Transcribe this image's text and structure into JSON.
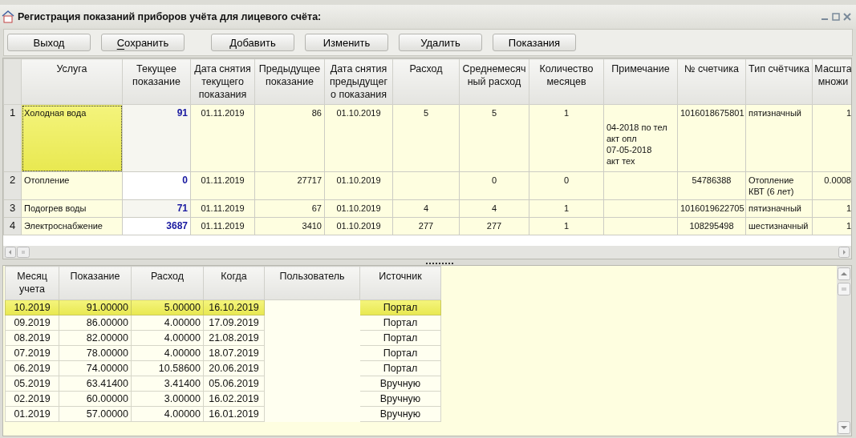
{
  "window": {
    "title": "Регистрация показаний приборов учёта для лицевого счёта:"
  },
  "toolbar": [
    {
      "label": "Выход",
      "mnemonic": false
    },
    {
      "label": "Сохранить",
      "mnemonic": true
    },
    {
      "label": "Добавить",
      "mnemonic": false
    },
    {
      "label": "Изменить",
      "mnemonic": false
    },
    {
      "label": "Удалить",
      "mnemonic": false
    },
    {
      "label": "Показания",
      "mnemonic": false
    }
  ],
  "readings_table": {
    "columns": [
      "Услуга",
      "Текущее показание",
      "Дата снятия текущего показания",
      "Предыдущее показание",
      "Дата снятия предыдущег о показания",
      "Расход",
      "Среднемесяч ный расход",
      "Количество месяцев",
      "Примечание",
      "№ счетчика",
      "Тип счётчика",
      "Масшта множи"
    ],
    "rows": [
      {
        "number": "1",
        "selected": true,
        "cells": [
          "Холодная вода",
          "91",
          "01.11.2019",
          "86",
          "01.10.2019",
          "5",
          "5",
          "1",
          "04-2018 по тел\nакт опл\n07-05-2018\nакт тех",
          "1016018675801",
          "пятизначный",
          "1"
        ]
      },
      {
        "number": "2",
        "selected": false,
        "cells": [
          "Отопление",
          "0",
          "01.11.2019",
          "27717",
          "01.10.2019",
          null,
          "0",
          "0",
          null,
          "54786388",
          "Отопление КВТ (6 лет)",
          "0.0008"
        ]
      },
      {
        "number": "3",
        "selected": false,
        "cells": [
          "Подогрев воды",
          "71",
          "01.11.2019",
          "67",
          "01.10.2019",
          "4",
          "4",
          "1",
          null,
          "1016019622705",
          "пятизначный",
          "1"
        ]
      },
      {
        "number": "4",
        "selected": false,
        "cells": [
          "Электроснабжение",
          "3687",
          "01.11.2019",
          "3410",
          "01.10.2019",
          "277",
          "277",
          "1",
          null,
          "108295498",
          "шестизначный",
          "1"
        ]
      }
    ]
  },
  "history_table": {
    "columns": [
      "Месяц учета",
      "Показание",
      "Расход",
      "Когда",
      "Пользователь",
      "Источник"
    ],
    "rows": [
      {
        "selected": true,
        "cells": [
          "10.2019",
          "91.00000",
          "5.00000",
          "16.10.2019",
          null,
          "Портал"
        ]
      },
      {
        "selected": false,
        "cells": [
          "09.2019",
          "86.00000",
          "4.00000",
          "17.09.2019",
          null,
          "Портал"
        ]
      },
      {
        "selected": false,
        "cells": [
          "08.2019",
          "82.00000",
          "4.00000",
          "21.08.2019",
          null,
          "Портал"
        ]
      },
      {
        "selected": false,
        "cells": [
          "07.2019",
          "78.00000",
          "4.00000",
          "18.07.2019",
          null,
          "Портал"
        ]
      },
      {
        "selected": false,
        "cells": [
          "06.2019",
          "74.00000",
          "10.58600",
          "20.06.2019",
          null,
          "Портал"
        ]
      },
      {
        "selected": false,
        "cells": [
          "05.2019",
          "63.41400",
          "3.41400",
          "05.06.2019",
          null,
          "Вручную"
        ]
      },
      {
        "selected": false,
        "cells": [
          "02.2019",
          "60.00000",
          "3.00000",
          "16.02.2019",
          null,
          "Вручную"
        ]
      },
      {
        "selected": false,
        "cells": [
          "01.2019",
          "57.00000",
          "4.00000",
          "16.01.2019",
          null,
          "Вручную"
        ]
      }
    ]
  }
}
